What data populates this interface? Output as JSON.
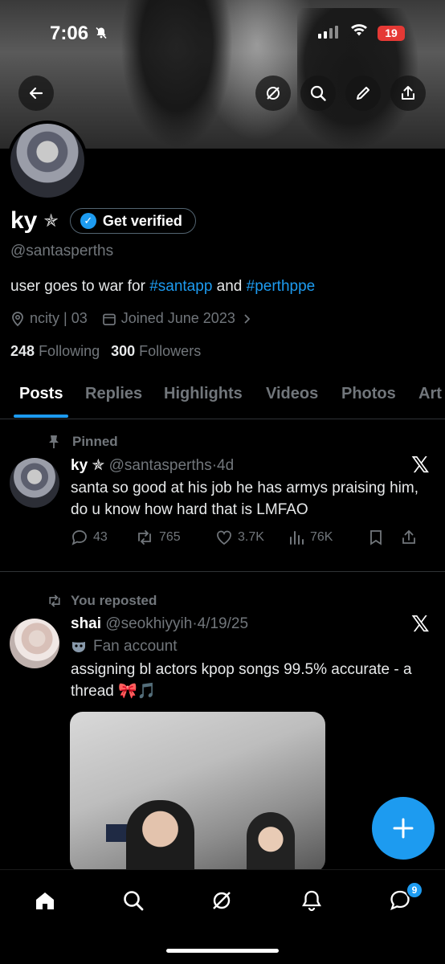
{
  "status": {
    "time": "7:06",
    "battery": "19"
  },
  "profile": {
    "name": "ky",
    "star": "✯",
    "get_verified": "Get verified",
    "handle": "@santasperths",
    "bio_prefix": "user goes to war for ",
    "bio_tag1": "#santapp",
    "bio_mid": " and ",
    "bio_tag2": "#perthppe",
    "location": "ncity | 03",
    "joined": "Joined June 2023",
    "following_count": "248",
    "following_label": "Following",
    "followers_count": "300",
    "followers_label": "Followers"
  },
  "tabs": [
    "Posts",
    "Replies",
    "Highlights",
    "Videos",
    "Photos",
    "Articles"
  ],
  "tab_visible": [
    "Posts",
    "Replies",
    "Highlights",
    "Videos",
    "Photos",
    "Art"
  ],
  "posts": [
    {
      "context": "Pinned",
      "name": "ky ✯",
      "handle": "@santasperths",
      "time": "4d",
      "text": "santa so good at his job he has armys praising him, do u know how hard that is LMFAO",
      "replies": "43",
      "reposts": "765",
      "likes": "3.7K",
      "views": "76K"
    },
    {
      "context": "You reposted",
      "name": "shai",
      "handle": "@seokhiyyih",
      "time": "4/19/25",
      "label": "Fan account",
      "text": "assigning bl actors kpop songs 99.5% accurate - a thread 🎀🎵"
    }
  ],
  "nav": {
    "messages_badge": "9"
  },
  "colors": {
    "accent": "#1d9bf0",
    "muted": "#71767b",
    "background": "#000000"
  }
}
